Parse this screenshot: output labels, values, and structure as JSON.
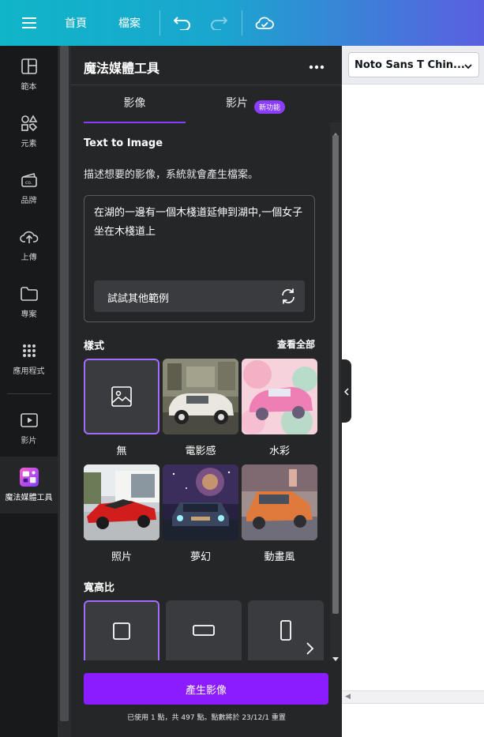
{
  "topbar": {
    "home_label": "首頁",
    "file_label": "檔案",
    "menu_icon": "hamburger-menu-icon",
    "undo_icon": "undo-icon",
    "redo_icon": "redo-icon",
    "cloud_icon": "cloud-saved-icon"
  },
  "sidebar": {
    "items": [
      {
        "label": "範本",
        "icon": "templates-icon"
      },
      {
        "label": "元素",
        "icon": "elements-icon"
      },
      {
        "label": "品牌",
        "icon": "brand-icon"
      },
      {
        "label": "上傳",
        "icon": "upload-icon"
      },
      {
        "label": "專案",
        "icon": "folder-icon"
      },
      {
        "label": "應用程式",
        "icon": "apps-grid-icon"
      },
      {
        "label": "影片",
        "icon": "video-icon"
      },
      {
        "label": "魔法媒體工具",
        "icon": "magic-media-icon"
      }
    ]
  },
  "panel": {
    "title": "魔法媒體工具",
    "more_icon": "more-options-icon",
    "tabs": [
      {
        "label": "影像",
        "active": true
      },
      {
        "label": "影片",
        "active": false
      }
    ],
    "new_badge": "新功能",
    "section_title": "Text to Image",
    "description": "描述想要的影像，系統就會產生檔案。",
    "prompt_text": "在湖的一邊有一個木棧道延伸到湖中,一個女子坐在木棧道上",
    "try_examples": "試試其他範例",
    "styles_title": "樣式",
    "see_all": "查看全部",
    "styles": [
      {
        "label": "無",
        "selected": true
      },
      {
        "label": "電影感",
        "selected": false
      },
      {
        "label": "水彩",
        "selected": false
      },
      {
        "label": "照片",
        "selected": false
      },
      {
        "label": "夢幻",
        "selected": false
      },
      {
        "label": "動畫風",
        "selected": false
      }
    ],
    "aspect_title": "寬高比",
    "aspect_options": [
      {
        "icon": "square-ratio-icon",
        "selected": true
      },
      {
        "icon": "landscape-ratio-icon",
        "selected": false
      },
      {
        "icon": "portrait-ratio-icon",
        "selected": false
      }
    ],
    "generate_button": "產生影像",
    "usage_note": "已使用 1 點，共 497 點。點數將於 23/12/1 重置"
  },
  "editor": {
    "font_select": "Noto Sans T Chin..."
  },
  "colors": {
    "accent": "#8b3dff",
    "generate": "#8b1cff",
    "topbar_start": "#10b5c8",
    "topbar_end": "#5a5fe0",
    "panel_bg": "#252627",
    "rail_bg": "#18191b"
  }
}
